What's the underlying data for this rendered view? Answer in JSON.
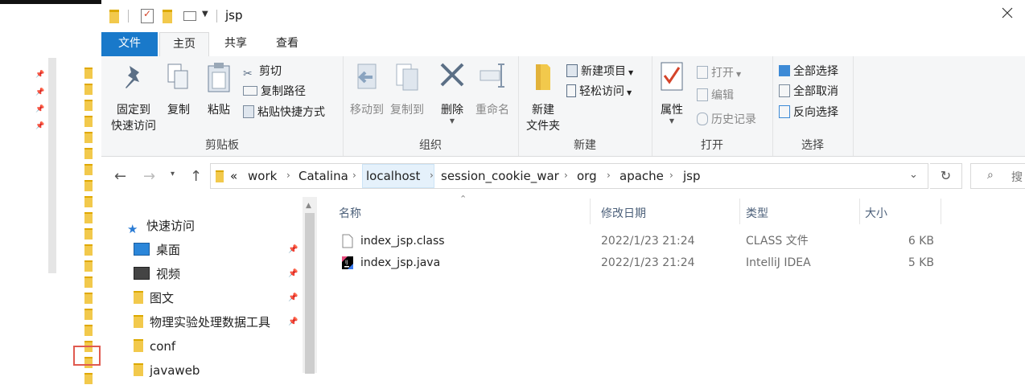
{
  "window": {
    "title": "jsp",
    "colors": {
      "file_tab": "#1979ca",
      "ribbon_bg": "#f5f6f7",
      "folder": "#f2c94c",
      "selection": "#e5f1fb"
    }
  },
  "ribbon_tabs": [
    "文件",
    "主页",
    "共享",
    "查看"
  ],
  "ribbon": {
    "clipboard": {
      "label": "剪贴板",
      "pin_line1": "固定到",
      "pin_line2": "快速访问",
      "copy": "复制",
      "paste": "粘贴",
      "cut": "剪切",
      "copy_path": "复制路径",
      "paste_shortcut": "粘贴快捷方式"
    },
    "organize": {
      "label": "组织",
      "move_to": "移动到",
      "copy_to": "复制到",
      "delete": "删除",
      "rename": "重命名"
    },
    "new": {
      "label": "新建",
      "new_folder_line1": "新建",
      "new_folder_line2": "文件夹",
      "new_item": "新建项目",
      "easy_access": "轻松访问"
    },
    "open": {
      "label": "打开",
      "properties": "属性",
      "open": "打开",
      "edit": "编辑",
      "history": "历史记录"
    },
    "select": {
      "label": "选择",
      "select_all": "全部选择",
      "select_none": "全部取消",
      "invert": "反向选择"
    }
  },
  "address": {
    "overflow": "«",
    "crumbs": [
      "work",
      "Catalina",
      "localhost",
      "session_cookie_war",
      "org",
      "apache",
      "jsp"
    ]
  },
  "search": {
    "placeholder": "搜"
  },
  "nav_pane": {
    "quick_access": "快速访问",
    "items": [
      {
        "label": "桌面",
        "icon": "desktop-icon",
        "pinned": true
      },
      {
        "label": "视频",
        "icon": "video-icon",
        "pinned": true
      },
      {
        "label": "图文",
        "icon": "folder-icon",
        "pinned": true
      },
      {
        "label": "物理实验处理数据工具",
        "icon": "folder-icon",
        "pinned": true
      },
      {
        "label": "conf",
        "icon": "folder-icon",
        "pinned": false
      },
      {
        "label": "javaweb",
        "icon": "folder-icon",
        "pinned": false
      }
    ]
  },
  "columns": [
    "名称",
    "修改日期",
    "类型",
    "大小"
  ],
  "files": [
    {
      "name": "index_jsp.class",
      "date": "2022/1/23 21:24",
      "type": "CLASS 文件",
      "size": "6 KB",
      "icon": "class-file-icon"
    },
    {
      "name": "index_jsp.java",
      "date": "2022/1/23 21:24",
      "type": "IntelliJ IDEA",
      "size": "5 KB",
      "icon": "intellij-file-icon"
    }
  ]
}
